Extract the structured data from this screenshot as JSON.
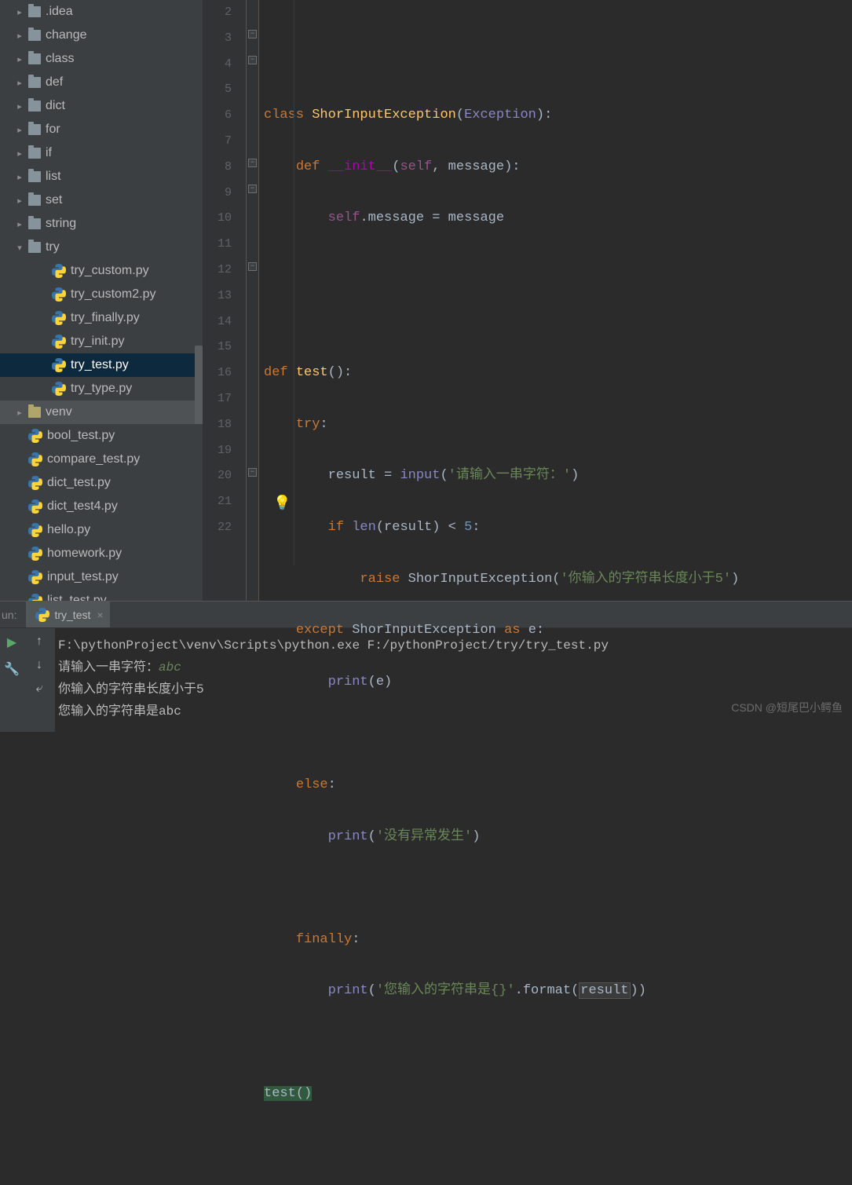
{
  "sidebar": {
    "items": [
      {
        "level": 1,
        "chevron": "▸",
        "type": "folder",
        "label": ".idea"
      },
      {
        "level": 1,
        "chevron": "▸",
        "type": "folder",
        "label": "change"
      },
      {
        "level": 1,
        "chevron": "▸",
        "type": "folder",
        "label": "class"
      },
      {
        "level": 1,
        "chevron": "▸",
        "type": "folder",
        "label": "def"
      },
      {
        "level": 1,
        "chevron": "▸",
        "type": "folder",
        "label": "dict"
      },
      {
        "level": 1,
        "chevron": "▸",
        "type": "folder",
        "label": "for"
      },
      {
        "level": 1,
        "chevron": "▸",
        "type": "folder",
        "label": "if"
      },
      {
        "level": 1,
        "chevron": "▸",
        "type": "folder",
        "label": "list"
      },
      {
        "level": 1,
        "chevron": "▸",
        "type": "folder",
        "label": "set"
      },
      {
        "level": 1,
        "chevron": "▸",
        "type": "folder",
        "label": "string"
      },
      {
        "level": 1,
        "chevron": "▾",
        "type": "folder",
        "label": "try"
      },
      {
        "level": 2,
        "chevron": "",
        "type": "py",
        "label": "try_custom.py"
      },
      {
        "level": 2,
        "chevron": "",
        "type": "py",
        "label": "try_custom2.py"
      },
      {
        "level": 2,
        "chevron": "",
        "type": "py",
        "label": "try_finally.py"
      },
      {
        "level": 2,
        "chevron": "",
        "type": "py",
        "label": "try_init.py"
      },
      {
        "level": 2,
        "chevron": "",
        "type": "py",
        "label": "try_test.py",
        "selected": true
      },
      {
        "level": 2,
        "chevron": "",
        "type": "py",
        "label": "try_type.py"
      },
      {
        "level": 1,
        "chevron": "▸",
        "type": "venv",
        "label": "venv",
        "venv": true
      },
      {
        "level": 1,
        "chevron": "",
        "type": "py",
        "label": "bool_test.py"
      },
      {
        "level": 1,
        "chevron": "",
        "type": "py",
        "label": "compare_test.py"
      },
      {
        "level": 1,
        "chevron": "",
        "type": "py",
        "label": "dict_test.py"
      },
      {
        "level": 1,
        "chevron": "",
        "type": "py",
        "label": "dict_test4.py"
      },
      {
        "level": 1,
        "chevron": "",
        "type": "py",
        "label": "hello.py"
      },
      {
        "level": 1,
        "chevron": "",
        "type": "py",
        "label": "homework.py"
      },
      {
        "level": 1,
        "chevron": "",
        "type": "py",
        "label": "input_test.py"
      },
      {
        "level": 1,
        "chevron": "",
        "type": "py",
        "label": "list_test.py"
      }
    ]
  },
  "code": {
    "lines": [
      "2",
      "3",
      "4",
      "5",
      "6",
      "7",
      "8",
      "9",
      "10",
      "11",
      "12",
      "13",
      "14",
      "15",
      "16",
      "17",
      "18",
      "19",
      "20",
      "21",
      "22"
    ],
    "l3": {
      "kw": "class",
      "name": "ShorInputException",
      "base": "Exception"
    },
    "l4": {
      "kw": "def",
      "dunder": "__init__",
      "self": "self",
      "param": "message"
    },
    "l5": {
      "self": "self",
      "attr": "message",
      "op": " = ",
      "rhs": "message"
    },
    "l8": {
      "kw": "def",
      "name": "test"
    },
    "l9": {
      "kw": "try"
    },
    "l10": {
      "var": "result",
      "fn": "input",
      "str": "'请输入一串字符：'"
    },
    "l11": {
      "kw": "if",
      "fn": "len",
      "var": "result",
      "op": " < ",
      "num": "5"
    },
    "l12": {
      "kw": "raise",
      "cls": "ShorInputException",
      "str": "'你输入的字符串长度小于5'"
    },
    "l13": {
      "kw": "except",
      "cls": "ShorInputException",
      "kw2": "as",
      "var": "e"
    },
    "l14": {
      "fn": "print",
      "var": "e"
    },
    "l16": {
      "kw": "else"
    },
    "l17": {
      "fn": "print",
      "str": "'没有异常发生'"
    },
    "l19": {
      "kw": "finally"
    },
    "l20": {
      "fn": "print",
      "str": "'您输入的字符串是{}'",
      "method": "format",
      "var": "result"
    },
    "l22": {
      "call": "test"
    }
  },
  "run": {
    "label": "un:",
    "tab": "try_test",
    "output": {
      "l1": "F:\\pythonProject\\venv\\Scripts\\python.exe F:/pythonProject/try/try_test.py",
      "l2a": "请输入一串字符：",
      "l2b": "abc",
      "l3": "你输入的字符串长度小于5",
      "l4": "您输入的字符串是abc"
    }
  },
  "watermark": "CSDN @短尾巴小鳄鱼"
}
